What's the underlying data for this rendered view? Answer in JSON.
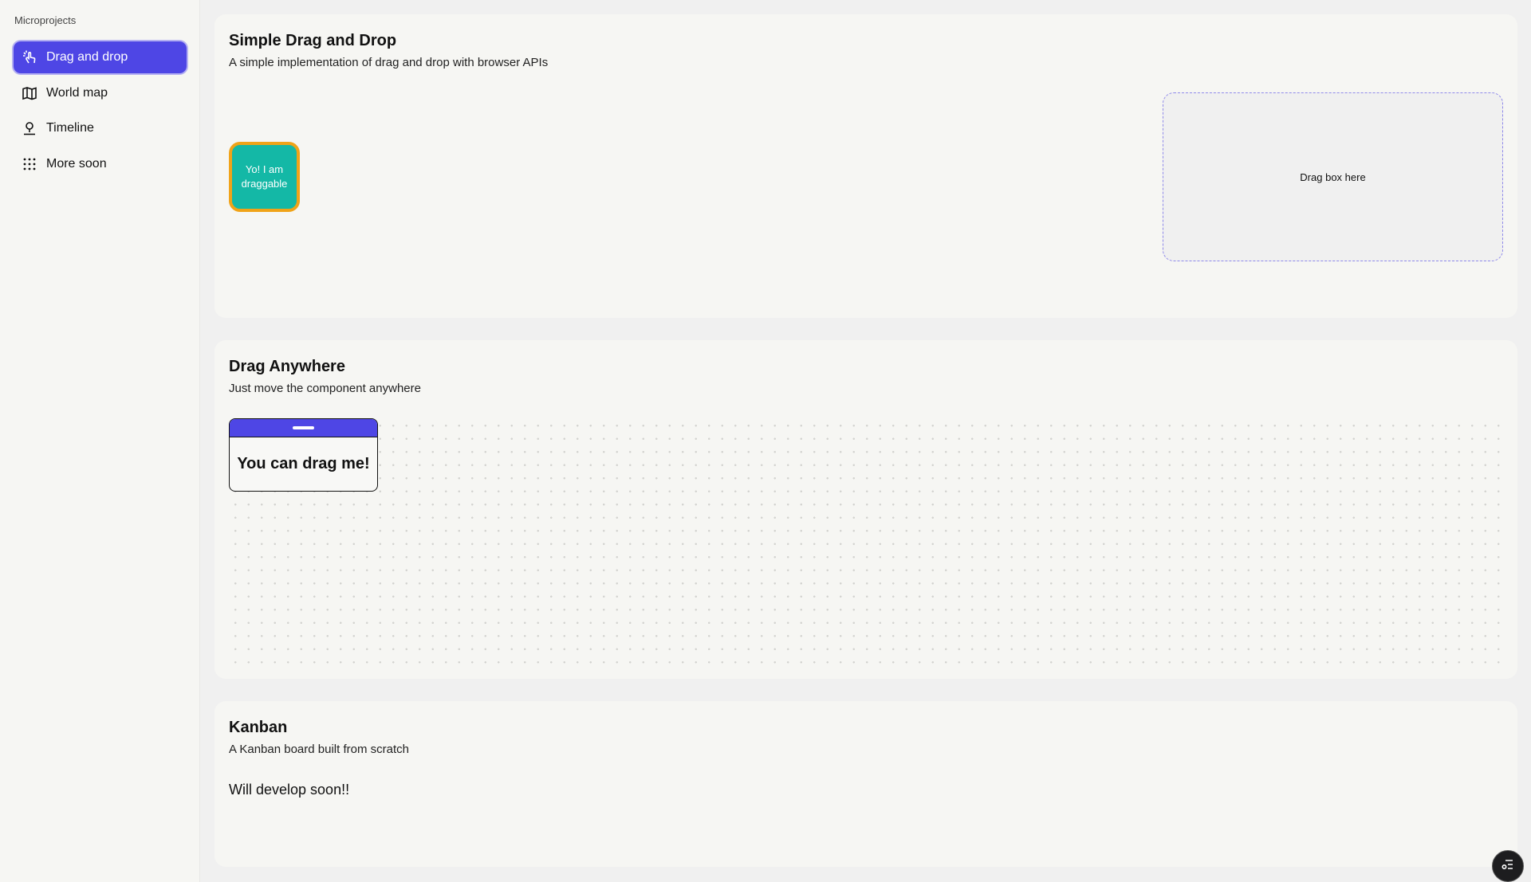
{
  "sidebar": {
    "title": "Microprojects",
    "items": [
      {
        "label": "Drag and drop",
        "icon": "drag-hand-icon",
        "active": true
      },
      {
        "label": "World map",
        "icon": "map-icon",
        "active": false
      },
      {
        "label": "Timeline",
        "icon": "map-pin-icon",
        "active": false
      },
      {
        "label": "More soon",
        "icon": "grid-dots-icon",
        "active": false
      }
    ]
  },
  "sections": {
    "simple": {
      "title": "Simple Drag and Drop",
      "subtitle": "A simple implementation of drag and drop with browser APIs",
      "draggable_label": "Yo! I am draggable",
      "dropzone_label": "Drag box here"
    },
    "anywhere": {
      "title": "Drag Anywhere",
      "subtitle": "Just move the component anywhere",
      "window_label": "You can drag me!"
    },
    "kanban": {
      "title": "Kanban",
      "subtitle": "A Kanban board built from scratch",
      "message": "Will develop soon!!"
    }
  },
  "fab": {
    "icon": "toolbar-menu-icon"
  },
  "colors": {
    "accent": "#4e46e5",
    "teal": "#14b8a6",
    "orange_border": "#f0a318",
    "card_bg": "#f6f6f3",
    "page_bg": "#f0f0f0"
  }
}
